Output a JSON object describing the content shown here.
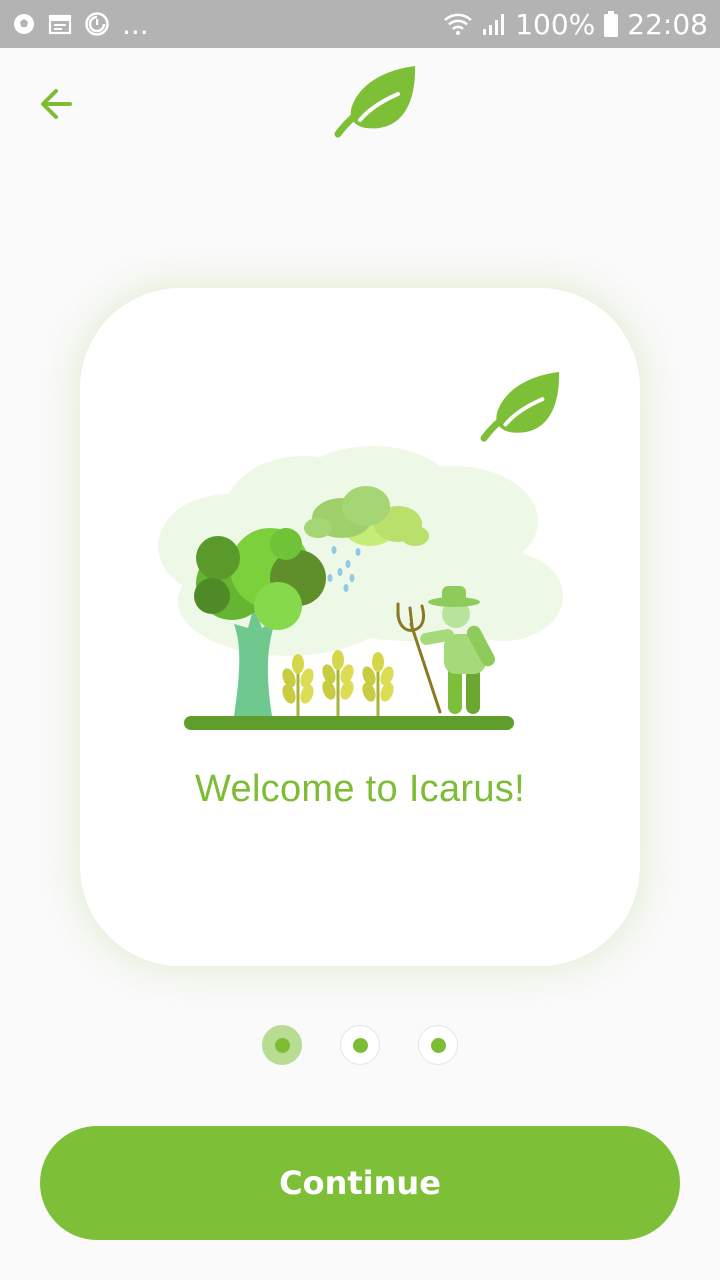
{
  "status_bar": {
    "icons": [
      "soccer-ball-icon",
      "calendar-icon",
      "sync-icon",
      "more-notifications-icon",
      "wifi-icon",
      "signal-icon",
      "battery-icon"
    ],
    "more": "...",
    "battery": "100%",
    "time": "22:08"
  },
  "header": {
    "back_icon": "arrow-left-icon",
    "logo_icon": "leaf-icon"
  },
  "card": {
    "leaf_icon": "leaf-icon",
    "illustration": "farmer-tree-rain-illustration",
    "title": "Welcome to Icarus!"
  },
  "pager": {
    "count": 3,
    "active_index": 0
  },
  "cta": {
    "label": "Continue"
  },
  "colors": {
    "brand_green": "#7dbf37",
    "title_green": "#7dbd36",
    "status_bar": "#b3b3b3",
    "background": "#fafafa"
  }
}
